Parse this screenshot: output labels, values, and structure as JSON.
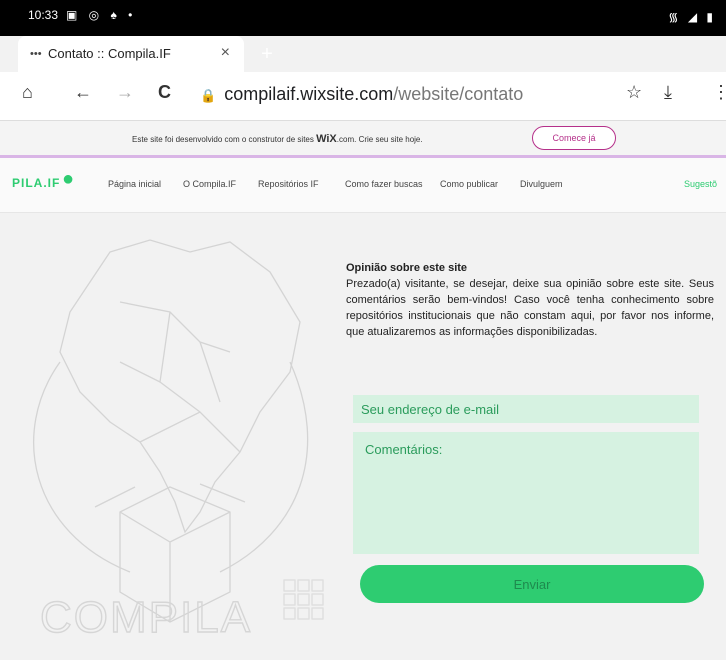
{
  "statusbar": {
    "time": "10:33",
    "icons": "▣ ◎ ♠ •",
    "right": "᯾ ◢ ▮"
  },
  "browser": {
    "tab_title": "Contato :: Compila.IF",
    "tab_favicon": "•••",
    "tab_close": "×",
    "new_tab": "+",
    "url_domain": "compilaif.wixsite.com",
    "url_path": "/website/contato"
  },
  "icons": {
    "home": "⌂",
    "back": "←",
    "forward": "→",
    "reload": "C",
    "lock": "🔒",
    "star": "☆",
    "download": "⤓",
    "menu": "⋮"
  },
  "wixbar": {
    "text_pre": "Este site foi desenvolvido com o construtor de sites ",
    "brand": "WiX",
    "text_post": ".com. Crie seu site hoje.",
    "button": "Comece já"
  },
  "site": {
    "logo": "PILA.IF",
    "nav": [
      "Página inicial",
      "O Compila.IF",
      "Repositórios IF",
      "Como fazer buscas",
      "Como publicar",
      "Divulguem",
      "Sugestõ"
    ],
    "watermark": "COMPILA"
  },
  "content": {
    "heading": "Opinião sobre este site",
    "paragraph": "Prezado(a) visitante, se desejar, deixe sua opinião sobre este site. Seus comentários serão bem-vindos! Caso você tenha conhecimento sobre repositórios institucionais que não constam aqui, por favor nos informe, que atualizaremos as informações disponibilizadas."
  },
  "form": {
    "email_placeholder": "Seu endereço de e-mail",
    "comments_placeholder": "Comentários:",
    "submit": "Enviar"
  },
  "colors": {
    "accent": "#2ecc71",
    "field": "#d6f2e1",
    "wix": "#b5308a"
  }
}
